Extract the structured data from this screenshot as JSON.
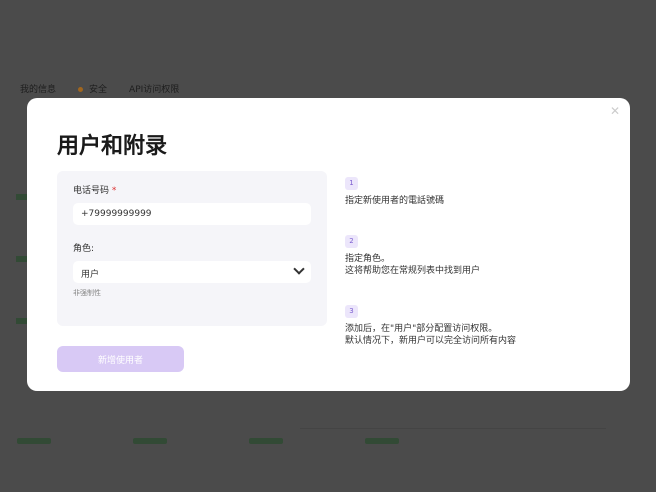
{
  "background": {
    "tabs": [
      {
        "label": "我的信息"
      },
      {
        "label": "安全"
      },
      {
        "label": "API访问权限"
      }
    ]
  },
  "modal": {
    "title": "用户和附录",
    "phone": {
      "label": "电话号码",
      "required_mark": "*",
      "value": "+79999999999"
    },
    "role": {
      "label": "角色:",
      "value": "用户",
      "hint": "非强制性"
    },
    "submit_label": "新增使用者",
    "close_icon": "close-icon",
    "steps": [
      {
        "number": "1",
        "text": "指定新使用者的電話號碼"
      },
      {
        "number": "2",
        "text": "指定角色。\n这将帮助您在常规列表中找到用户"
      },
      {
        "number": "3",
        "text": "添加后，在\"用户\"部分配置访问权限。\n默认情况下，新用户可以完全访问所有内容"
      }
    ]
  },
  "colors": {
    "accent": "#d8c9f5",
    "overlay": "#4b4b4b"
  }
}
